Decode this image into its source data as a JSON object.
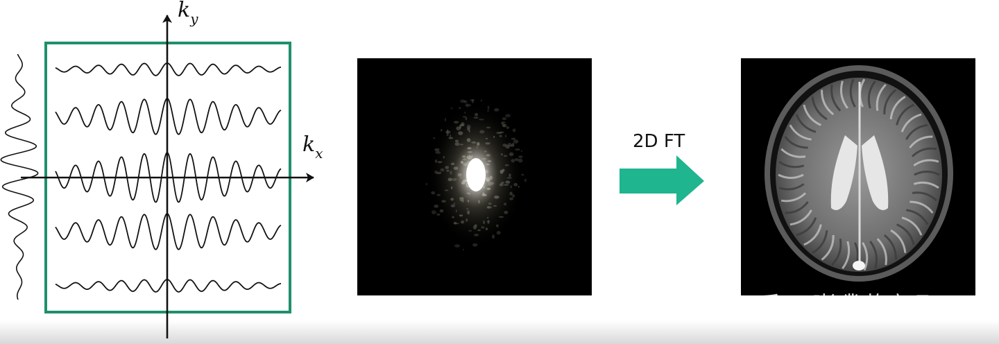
{
  "kspace_axes": {
    "x_label": "k",
    "x_sub": "x",
    "y_label": "k",
    "y_sub": "y",
    "box_color": "#1f8f6c"
  },
  "transform": {
    "label": "2D FT",
    "arrow_color": "#1fb58f"
  },
  "watermark": {
    "text": "知乎 @嘭噗啪嚓吧"
  },
  "panels": {
    "kspace_image": "kspace-signal-image",
    "brain_image": "axial-brain-mri-image"
  }
}
